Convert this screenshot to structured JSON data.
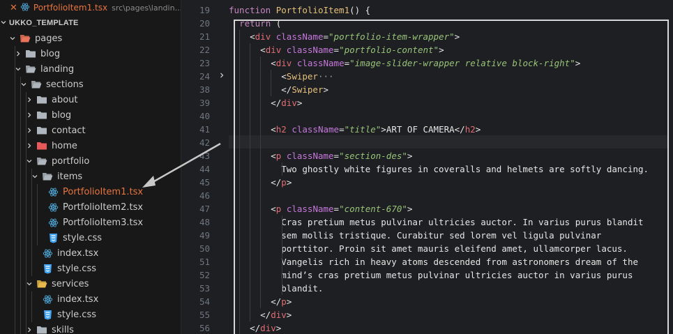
{
  "open_editor": {
    "file_name": "PortfolioItem1.tsx",
    "file_path": "src\\pages\\landin..."
  },
  "workspace": {
    "title": "UKKO_TEMPLATE"
  },
  "tree": [
    {
      "label": "pages",
      "kind": "folder-special",
      "open": true,
      "depth": 1,
      "color": "#e8745a"
    },
    {
      "label": "blog",
      "kind": "folder",
      "open": false,
      "depth": 2
    },
    {
      "label": "landing",
      "kind": "folder",
      "open": true,
      "depth": 2
    },
    {
      "label": "sections",
      "kind": "folder",
      "open": true,
      "depth": 3
    },
    {
      "label": "about",
      "kind": "folder",
      "open": false,
      "depth": 4
    },
    {
      "label": "blog",
      "kind": "folder",
      "open": false,
      "depth": 4
    },
    {
      "label": "contact",
      "kind": "folder",
      "open": false,
      "depth": 4
    },
    {
      "label": "home",
      "kind": "folder-special",
      "open": false,
      "depth": 4,
      "color": "#e85a5a"
    },
    {
      "label": "portfolio",
      "kind": "folder",
      "open": true,
      "depth": 4
    },
    {
      "label": "items",
      "kind": "folder",
      "open": true,
      "depth": 5
    },
    {
      "label": "PortfolioItem1.tsx",
      "kind": "react",
      "depth": 6,
      "active": true
    },
    {
      "label": "PortfolioItem2.tsx",
      "kind": "react",
      "depth": 6
    },
    {
      "label": "PortfolioItem3.tsx",
      "kind": "react",
      "depth": 6
    },
    {
      "label": "style.css",
      "kind": "css",
      "depth": 6
    },
    {
      "label": "index.tsx",
      "kind": "react",
      "depth": 5
    },
    {
      "label": "style.css",
      "kind": "css",
      "depth": 5
    },
    {
      "label": "services",
      "kind": "folder-special",
      "open": true,
      "depth": 4,
      "color": "#e8b84a"
    },
    {
      "label": "index.tsx",
      "kind": "react",
      "depth": 5
    },
    {
      "label": "style.css",
      "kind": "css",
      "depth": 5
    },
    {
      "label": "skills",
      "kind": "folder",
      "open": false,
      "depth": 4
    }
  ],
  "code_lines": [
    {
      "num": "19",
      "tokens": [
        [
          "kw",
          "function "
        ],
        [
          "fn",
          "PortfolioItem1"
        ],
        [
          "punc",
          "() {"
        ]
      ]
    },
    {
      "num": "20",
      "tokens": [
        [
          "text",
          "  "
        ],
        [
          "kw",
          "return "
        ],
        [
          "punc",
          "("
        ]
      ]
    },
    {
      "num": "21",
      "tokens": [
        [
          "text",
          "    "
        ],
        [
          "punc",
          "<"
        ],
        [
          "tag",
          "div "
        ],
        [
          "attr",
          "className"
        ],
        [
          "punc",
          "="
        ],
        [
          "str",
          "\"portfolio-item-wrapper\""
        ],
        [
          "punc",
          ">"
        ]
      ]
    },
    {
      "num": "22",
      "tokens": [
        [
          "text",
          "      "
        ],
        [
          "punc",
          "<"
        ],
        [
          "tag",
          "div "
        ],
        [
          "attr",
          "className"
        ],
        [
          "punc",
          "="
        ],
        [
          "str",
          "\"portfolio-content\""
        ],
        [
          "punc",
          ">"
        ]
      ]
    },
    {
      "num": "23",
      "tokens": [
        [
          "text",
          "        "
        ],
        [
          "punc",
          "<"
        ],
        [
          "tag",
          "div "
        ],
        [
          "attr",
          "className"
        ],
        [
          "punc",
          "="
        ],
        [
          "str",
          "\"image-slider-wrapper relative block-right\""
        ],
        [
          "punc",
          ">"
        ]
      ]
    },
    {
      "num": "24",
      "fold": true,
      "tokens": [
        [
          "text",
          "          "
        ],
        [
          "punc",
          "<"
        ],
        [
          "comp",
          "Swiper"
        ],
        [
          "ell",
          "···"
        ]
      ]
    },
    {
      "num": "38",
      "tokens": [
        [
          "text",
          "          "
        ],
        [
          "punc",
          "</"
        ],
        [
          "comp",
          "Swiper"
        ],
        [
          "punc",
          ">"
        ]
      ]
    },
    {
      "num": "39",
      "tokens": [
        [
          "text",
          "        "
        ],
        [
          "punc",
          "</"
        ],
        [
          "tag",
          "div"
        ],
        [
          "punc",
          ">"
        ]
      ]
    },
    {
      "num": "40",
      "tokens": []
    },
    {
      "num": "41",
      "tokens": [
        [
          "text",
          "        "
        ],
        [
          "punc",
          "<"
        ],
        [
          "tag",
          "h2 "
        ],
        [
          "attr",
          "className"
        ],
        [
          "punc",
          "="
        ],
        [
          "str",
          "\"title\""
        ],
        [
          "punc",
          ">"
        ],
        [
          "text",
          "ART OF CAMERA"
        ],
        [
          "punc",
          "</"
        ],
        [
          "tag",
          "h2"
        ],
        [
          "punc",
          ">"
        ]
      ]
    },
    {
      "num": "42",
      "tokens": []
    },
    {
      "num": "43",
      "tokens": [
        [
          "text",
          "        "
        ],
        [
          "punc",
          "<"
        ],
        [
          "tag",
          "p "
        ],
        [
          "attr",
          "className"
        ],
        [
          "punc",
          "="
        ],
        [
          "str",
          "\"section-des\""
        ],
        [
          "punc",
          ">"
        ]
      ]
    },
    {
      "num": "44",
      "tokens": [
        [
          "text",
          "          Two ghostly white figures in coveralls and helmets are softly dancing."
        ]
      ]
    },
    {
      "num": "45",
      "tokens": [
        [
          "text",
          "        "
        ],
        [
          "punc",
          "</"
        ],
        [
          "tag",
          "p"
        ],
        [
          "punc",
          ">"
        ]
      ]
    },
    {
      "num": "46",
      "tokens": []
    },
    {
      "num": "47",
      "tokens": [
        [
          "text",
          "        "
        ],
        [
          "punc",
          "<"
        ],
        [
          "tag",
          "p "
        ],
        [
          "attr",
          "className"
        ],
        [
          "punc",
          "="
        ],
        [
          "str",
          "\"content-670\""
        ],
        [
          "punc",
          ">"
        ]
      ]
    },
    {
      "num": "48",
      "tokens": [
        [
          "text",
          "          Cras pretium metus pulvinar ultricies auctor. In varius purus blandit"
        ]
      ]
    },
    {
      "num": "49",
      "tokens": [
        [
          "text",
          "          sem mollis tristique. Curabitur sed lorem vel ligula pulvinar"
        ]
      ]
    },
    {
      "num": "50",
      "tokens": [
        [
          "text",
          "          porttitor. Proin sit amet mauris eleifend amet, ullamcorper lacus."
        ]
      ]
    },
    {
      "num": "51",
      "tokens": [
        [
          "text",
          "          Vangelis rich in heavy atoms descended from astronomers dream of the"
        ]
      ]
    },
    {
      "num": "52",
      "tokens": [
        [
          "text",
          "          mind’s cras pretium metus pulvinar ultricies auctor in varius purus"
        ]
      ]
    },
    {
      "num": "53",
      "tokens": [
        [
          "text",
          "          blandit."
        ]
      ]
    },
    {
      "num": "54",
      "tokens": [
        [
          "text",
          "        "
        ],
        [
          "punc",
          "</"
        ],
        [
          "tag",
          "p"
        ],
        [
          "punc",
          ">"
        ]
      ]
    },
    {
      "num": "55",
      "tokens": [
        [
          "text",
          "      "
        ],
        [
          "punc",
          "</"
        ],
        [
          "tag",
          "div"
        ],
        [
          "punc",
          ">"
        ]
      ]
    },
    {
      "num": "56",
      "tokens": [
        [
          "text",
          "    "
        ],
        [
          "punc",
          "</"
        ],
        [
          "tag",
          "div"
        ],
        [
          "punc",
          ">"
        ]
      ]
    }
  ],
  "colors": {
    "accent": "#e8743b",
    "react": "#4fa8d8",
    "css": "#42a5f5",
    "folder": "#b0b6bd"
  },
  "icons": {
    "react": "react-icon",
    "css": "css-icon",
    "folder": "folder-icon",
    "close": "close-icon"
  }
}
